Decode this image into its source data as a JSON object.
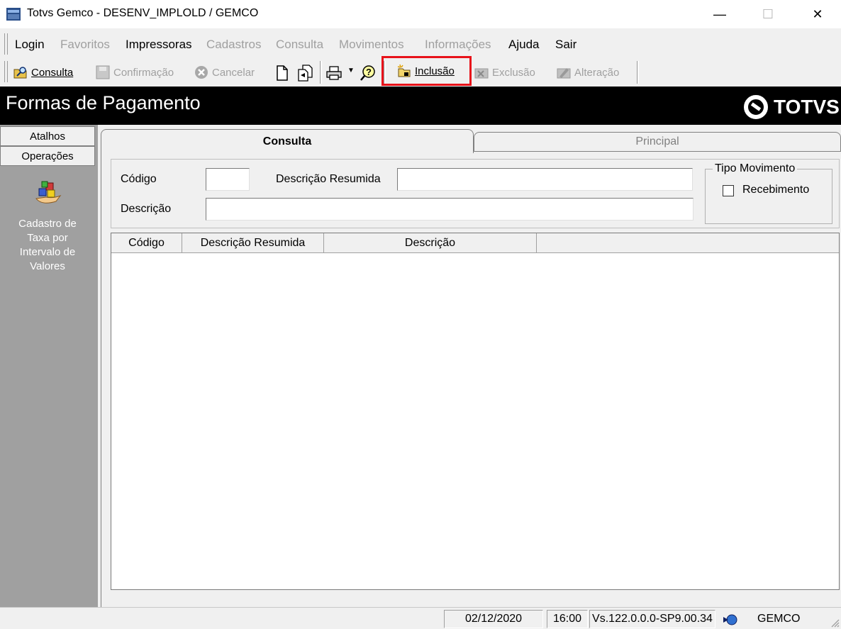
{
  "window": {
    "title": "Totvs Gemco - DESENV_IMPLOLD / GEMCO"
  },
  "menu": {
    "items": [
      {
        "label": "Login",
        "enabled": true
      },
      {
        "label": "Favoritos",
        "enabled": false
      },
      {
        "label": "Impressoras",
        "enabled": true
      },
      {
        "label": "Cadastros",
        "enabled": false
      },
      {
        "label": "Consulta",
        "enabled": false
      },
      {
        "label": "Movimentos",
        "enabled": false
      },
      {
        "label": "Informações",
        "enabled": false
      },
      {
        "label": "Ajuda",
        "enabled": true
      },
      {
        "label": "Sair",
        "enabled": true
      }
    ]
  },
  "toolbar": {
    "consulta": "Consulta",
    "confirmacao": "Confirmação",
    "cancelar": "Cancelar",
    "inclusao": "Inclusão",
    "exclusao": "Exclusão",
    "alteracao": "Alteração"
  },
  "header": {
    "title": "Formas de Pagamento",
    "logo": "TOTVS"
  },
  "sidebar": {
    "tabs": [
      "Atalhos",
      "Operações"
    ],
    "entry": [
      "Cadastro de",
      "Taxa por",
      "Intervalo de",
      "Valores"
    ]
  },
  "tabs": {
    "consulta": "Consulta",
    "principal": "Principal"
  },
  "form": {
    "codigo_label": "Código",
    "codigo_value": "",
    "descricao_resumida_label": "Descrição Resumida",
    "descricao_resumida_value": "",
    "descricao_label": "Descrição",
    "descricao_value": "",
    "tipo_movimento": {
      "legend": "Tipo Movimento",
      "option": "Recebimento",
      "checked": false
    }
  },
  "grid": {
    "columns": [
      "Código",
      "Descrição Resumida",
      "Descrição"
    ],
    "rows": []
  },
  "status": {
    "date": "02/12/2020",
    "time": "16:00",
    "version": "Vs.122.0.0.0-SP9.00.34",
    "company": "GEMCO"
  },
  "colors": {
    "highlight": "#e8121a",
    "header_bg": "#000000",
    "sidebar_bg": "#a0a0a0"
  }
}
